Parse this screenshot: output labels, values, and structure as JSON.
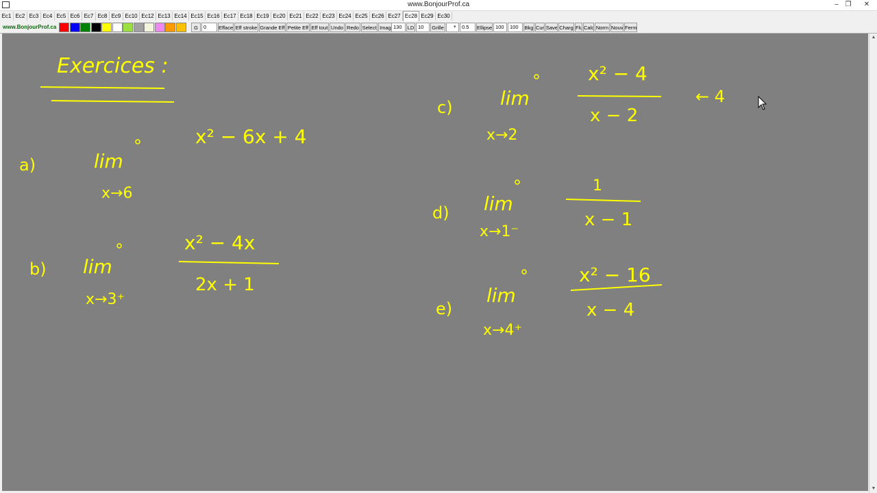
{
  "window": {
    "title": "www.BonjourProf.ca",
    "controls": {
      "minimize": "–",
      "restore": "❐",
      "close": "✕"
    }
  },
  "tabs": {
    "items": [
      "Ec1",
      "Ec2",
      "Ec3",
      "Ec4",
      "Ec5",
      "Ec6",
      "Ec7",
      "Ec8",
      "Ec9",
      "Ec10",
      "Ec12",
      "Ec13",
      "Ec14",
      "Ec15",
      "Ec16",
      "Ec17",
      "Ec18",
      "Ec19",
      "Ec20",
      "Ec21",
      "Ec22",
      "Ec23",
      "Ec24",
      "Ec25",
      "Ec26",
      "Ec27",
      "Ec28",
      "Ec29",
      "Ec30"
    ],
    "active": "Ec28"
  },
  "toolbar": {
    "site_label": "www.BonjourProf.ca",
    "colors": [
      "#ff0000",
      "#0000ff",
      "#008000",
      "#000000",
      "#ffff00",
      "#ffffff",
      "#99e040",
      "#a0a0a0",
      "#f5f5dc",
      "#ee88ee",
      "#ff9900",
      "#ffc000"
    ],
    "g_button": "G",
    "g_value": "0",
    "buttons": [
      "Efface",
      "Eff stroke",
      "Grande Eff",
      "Petite Eff",
      "Eff tout",
      "Undo",
      "Redo",
      "Select",
      "Image"
    ],
    "image_value": "130",
    "ld_label": "LD",
    "ld_value": "10",
    "grille_label": "Grille",
    "grille_value": "",
    "size_value": "0.5",
    "ellipse_label": "Ellipse",
    "ellipse_w": "100",
    "ellipse_h": "100",
    "buttons2": [
      "Bkg",
      "Cur",
      "Save",
      "Charg",
      "Flu",
      "Calc",
      "Norm",
      "Nouv",
      "Ferm"
    ]
  },
  "board": {
    "ink_color": "#ffff00",
    "background": "#808080",
    "heading": "Exercices :",
    "exercises": [
      {
        "label": "a)",
        "lim": "lim",
        "under": "x→6",
        "expr": "x² − 6x + 4"
      },
      {
        "label": "b)",
        "lim": "lim",
        "under": "x→3⁺",
        "numerator": "x² − 4x",
        "denominator": "2x + 1"
      },
      {
        "label": "c)",
        "lim": "lim",
        "under": "x→2",
        "numerator": "x² − 4",
        "denominator": "x − 2",
        "note": "←  4"
      },
      {
        "label": "d)",
        "lim": "lim",
        "under": "x→1⁻",
        "numerator": "1",
        "denominator": "x − 1"
      },
      {
        "label": "e)",
        "lim": "lim",
        "under": "x→4⁺",
        "numerator": "x² − 16",
        "denominator": "x − 4"
      }
    ]
  }
}
